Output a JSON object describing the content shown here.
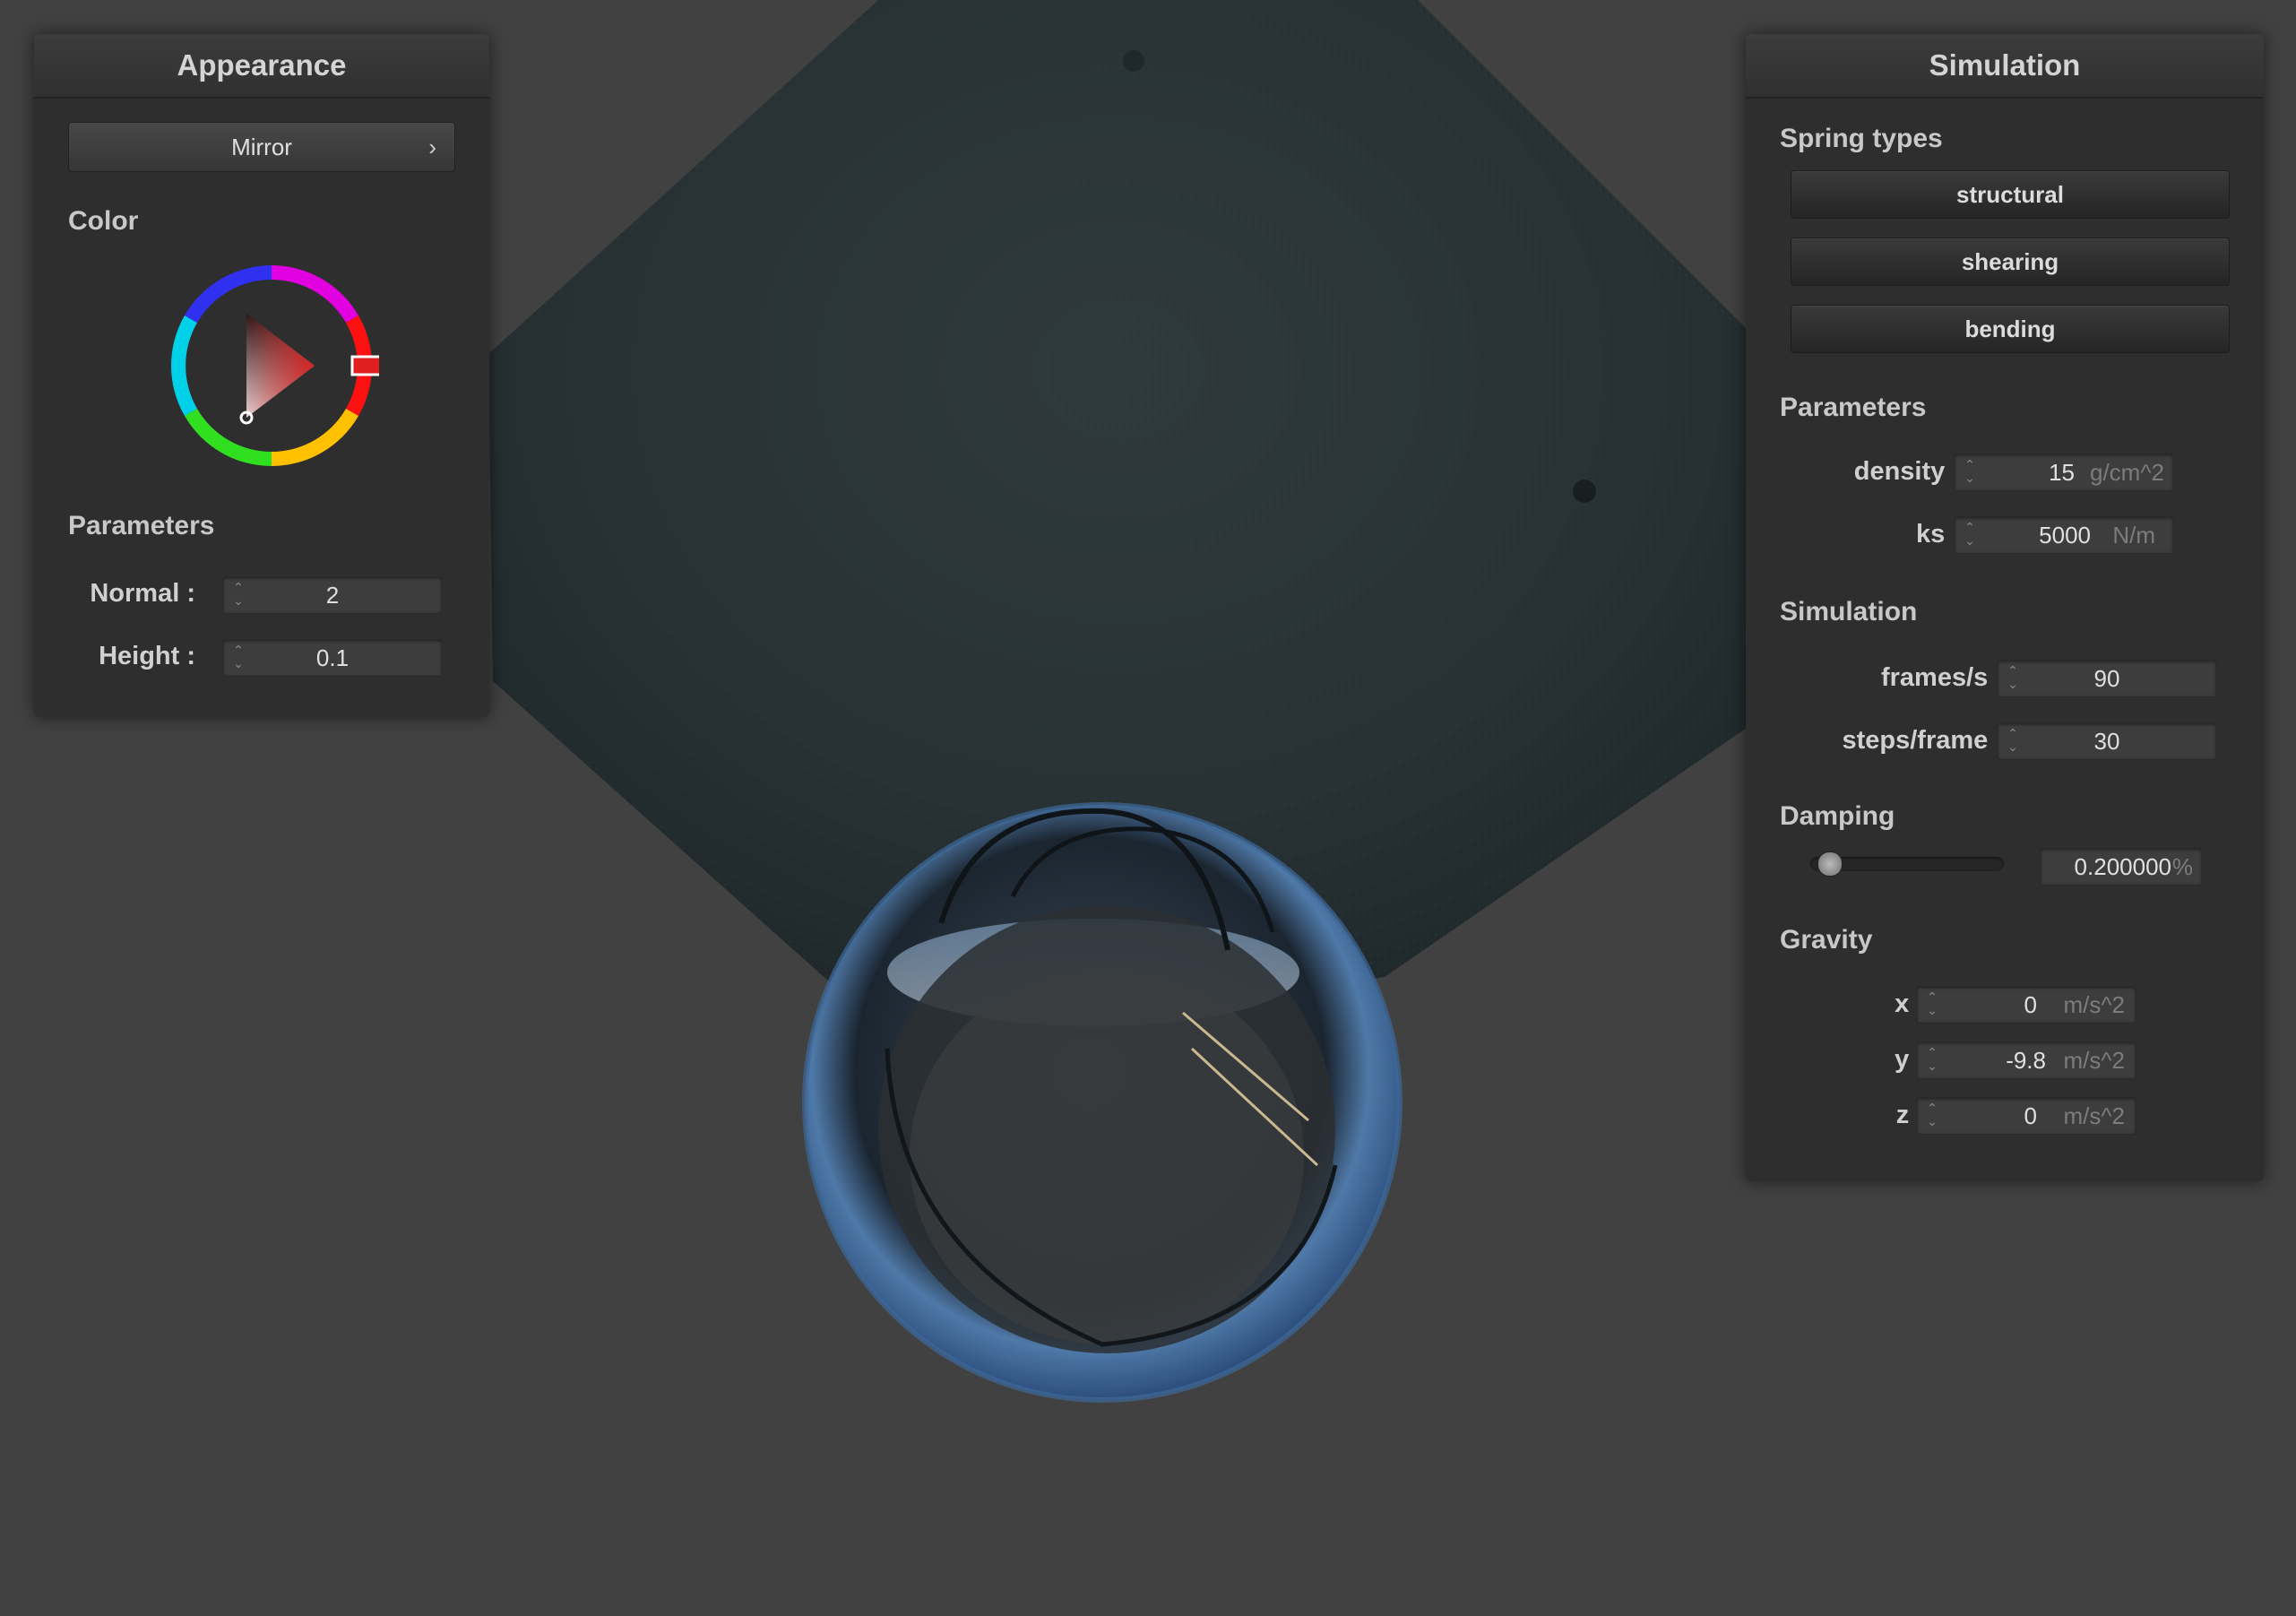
{
  "appearance": {
    "title": "Appearance",
    "shader_select": "Mirror",
    "color_label": "Color",
    "color_value": "#e02020",
    "parameters_label": "Parameters",
    "normal_label": "Normal :",
    "normal_value": "2",
    "height_label": "Height :",
    "height_value": "0.1"
  },
  "simulation_panel": {
    "title": "Simulation",
    "spring_types_label": "Spring types",
    "spring_buttons": [
      "structural",
      "shearing",
      "bending"
    ],
    "parameters_label": "Parameters",
    "density_label": "density :",
    "density_value": "15",
    "density_unit": "g/cm^2",
    "ks_label": "ks :",
    "ks_value": "5000",
    "ks_unit": "N/m",
    "simulation_label": "Simulation",
    "fps_label": "frames/s :",
    "fps_value": "90",
    "steps_label": "steps/frame :",
    "steps_value": "30",
    "damping_label": "Damping",
    "damping_value": "0.200000",
    "damping_unit": "%",
    "damping_fraction": 0.2,
    "gravity_label": "Gravity",
    "gx_label": "x :",
    "gx_value": "0",
    "gy_label": "y :",
    "gy_value": "-9.8",
    "gz_label": "z :",
    "gz_value": "0",
    "g_unit": "m/s^2"
  },
  "icons": {
    "spin": "spinner-arrows-icon",
    "chevron": "chevron-right-icon"
  },
  "colors": {
    "background": "#414141",
    "panel": "#2e2e2e"
  }
}
